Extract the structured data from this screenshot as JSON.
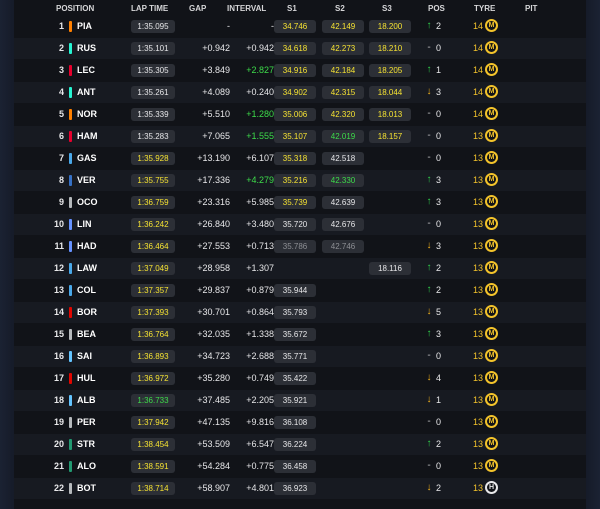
{
  "headers": {
    "position": "POSITION",
    "lap_time": "LAP TIME",
    "gap": "GAP",
    "interval": "INTERVAL",
    "s1": "S1",
    "s2": "S2",
    "s3": "S3",
    "pos": "POS",
    "tyre": "TYRE",
    "pit": "PIT"
  },
  "colors": {
    "yellow_sector": "#f5e232",
    "green_sector": "#3ddc4a",
    "pos_up": "#2fcf4a",
    "pos_down": "#f3b21b",
    "medium_tyre": "#f3c32b"
  },
  "rows": [
    {
      "pos": "1",
      "code": "PIA",
      "team_color": "#ff8000",
      "lap": "1:35.095",
      "lap_c": "white",
      "gap": "-",
      "interval": "-",
      "int_c": "white",
      "s1": "34.746",
      "s1_c": "yellow",
      "s2": "42.149",
      "s2_c": "yellow",
      "s3": "18.200",
      "s3_c": "yellow",
      "arrow": "up",
      "pchange": "2",
      "laps": "14",
      "tyre": "M"
    },
    {
      "pos": "2",
      "code": "RUS",
      "team_color": "#27f4d2",
      "lap": "1:35.101",
      "lap_c": "white",
      "gap": "+0.942",
      "interval": "+0.942",
      "int_c": "white",
      "s1": "34.618",
      "s1_c": "yellow",
      "s2": "42.273",
      "s2_c": "yellow",
      "s3": "18.210",
      "s3_c": "yellow",
      "arrow": "same",
      "pchange": "0",
      "laps": "14",
      "tyre": "M"
    },
    {
      "pos": "3",
      "code": "LEC",
      "team_color": "#e8002d",
      "lap": "1:35.305",
      "lap_c": "white",
      "gap": "+3.849",
      "interval": "+2.827",
      "int_c": "green",
      "s1": "34.916",
      "s1_c": "yellow",
      "s2": "42.184",
      "s2_c": "yellow",
      "s3": "18.205",
      "s3_c": "yellow",
      "arrow": "up",
      "pchange": "1",
      "laps": "14",
      "tyre": "M"
    },
    {
      "pos": "4",
      "code": "ANT",
      "team_color": "#27f4d2",
      "lap": "1:35.261",
      "lap_c": "white",
      "gap": "+4.089",
      "interval": "+0.240",
      "int_c": "white",
      "s1": "34.902",
      "s1_c": "yellow",
      "s2": "42.315",
      "s2_c": "yellow",
      "s3": "18.044",
      "s3_c": "yellow",
      "arrow": "down",
      "pchange": "3",
      "laps": "14",
      "tyre": "M"
    },
    {
      "pos": "5",
      "code": "NOR",
      "team_color": "#ff8000",
      "lap": "1:35.339",
      "lap_c": "white",
      "gap": "+5.510",
      "interval": "+1.280",
      "int_c": "green",
      "s1": "35.006",
      "s1_c": "yellow",
      "s2": "42.320",
      "s2_c": "yellow",
      "s3": "18.013",
      "s3_c": "yellow",
      "arrow": "same",
      "pchange": "0",
      "laps": "14",
      "tyre": "M"
    },
    {
      "pos": "6",
      "code": "HAM",
      "team_color": "#e8002d",
      "lap": "1:35.283",
      "lap_c": "white",
      "gap": "+7.065",
      "interval": "+1.555",
      "int_c": "green",
      "s1": "35.107",
      "s1_c": "yellow",
      "s2": "42.019",
      "s2_c": "green",
      "s3": "18.157",
      "s3_c": "yellow",
      "arrow": "same",
      "pchange": "0",
      "laps": "13",
      "tyre": "M"
    },
    {
      "pos": "7",
      "code": "GAS",
      "team_color": "#4aa8e8",
      "lap": "1:35.928",
      "lap_c": "yellow",
      "gap": "+13.190",
      "interval": "+6.107",
      "int_c": "white",
      "s1": "35.318",
      "s1_c": "yellow",
      "s2": "42.518",
      "s2_c": "white",
      "s3": "",
      "s3_c": "white",
      "arrow": "same",
      "pchange": "0",
      "laps": "13",
      "tyre": "M"
    },
    {
      "pos": "8",
      "code": "VER",
      "team_color": "#3671c6",
      "lap": "1:35.755",
      "lap_c": "yellow",
      "gap": "+17.336",
      "interval": "+4.279",
      "int_c": "green",
      "s1": "35.216",
      "s1_c": "yellow",
      "s2": "42.330",
      "s2_c": "green",
      "s3": "",
      "s3_c": "white",
      "arrow": "up",
      "pchange": "3",
      "laps": "13",
      "tyre": "M"
    },
    {
      "pos": "9",
      "code": "OCO",
      "team_color": "#b6babd",
      "lap": "1:36.759",
      "lap_c": "yellow",
      "gap": "+23.316",
      "interval": "+5.985",
      "int_c": "white",
      "s1": "35.739",
      "s1_c": "yellow",
      "s2": "42.639",
      "s2_c": "white",
      "s3": "",
      "s3_c": "white",
      "arrow": "up",
      "pchange": "3",
      "laps": "13",
      "tyre": "M"
    },
    {
      "pos": "10",
      "code": "LIN",
      "team_color": "#6692ff",
      "lap": "1:36.242",
      "lap_c": "yellow",
      "gap": "+26.840",
      "interval": "+3.480",
      "int_c": "white",
      "s1": "35.720",
      "s1_c": "white",
      "s2": "42.676",
      "s2_c": "white",
      "s3": "",
      "s3_c": "white",
      "arrow": "same",
      "pchange": "0",
      "laps": "13",
      "tyre": "M"
    },
    {
      "pos": "11",
      "code": "HAD",
      "team_color": "#6692ff",
      "lap": "1:36.464",
      "lap_c": "yellow",
      "gap": "+27.553",
      "interval": "+0.713",
      "int_c": "white",
      "s1": "35.786",
      "s1_c": "grey",
      "s2": "42.746",
      "s2_c": "grey",
      "s3": "",
      "s3_c": "white",
      "arrow": "down",
      "pchange": "3",
      "laps": "13",
      "tyre": "M"
    },
    {
      "pos": "12",
      "code": "LAW",
      "team_color": "#4aa8e8",
      "lap": "1:37.049",
      "lap_c": "yellow",
      "gap": "+28.958",
      "interval": "+1.307",
      "int_c": "white",
      "s1": "",
      "s1_c": "white",
      "s2": "",
      "s2_c": "white",
      "s3": "18.116",
      "s3_c": "white",
      "arrow": "up",
      "pchange": "2",
      "laps": "13",
      "tyre": "M"
    },
    {
      "pos": "13",
      "code": "COL",
      "team_color": "#4aa8e8",
      "lap": "1:37.357",
      "lap_c": "yellow",
      "gap": "+29.837",
      "interval": "+0.879",
      "int_c": "white",
      "s1": "35.944",
      "s1_c": "white",
      "s2": "",
      "s2_c": "white",
      "s3": "",
      "s3_c": "white",
      "arrow": "up",
      "pchange": "2",
      "laps": "13",
      "tyre": "M"
    },
    {
      "pos": "14",
      "code": "BOR",
      "team_color": "#e10600",
      "lap": "1:37.393",
      "lap_c": "yellow",
      "gap": "+30.701",
      "interval": "+0.864",
      "int_c": "white",
      "s1": "35.793",
      "s1_c": "white",
      "s2": "",
      "s2_c": "white",
      "s3": "",
      "s3_c": "white",
      "arrow": "down",
      "pchange": "5",
      "laps": "13",
      "tyre": "M"
    },
    {
      "pos": "15",
      "code": "BEA",
      "team_color": "#b6babd",
      "lap": "1:36.764",
      "lap_c": "yellow",
      "gap": "+32.035",
      "interval": "+1.338",
      "int_c": "white",
      "s1": "35.672",
      "s1_c": "white",
      "s2": "",
      "s2_c": "white",
      "s3": "",
      "s3_c": "white",
      "arrow": "up",
      "pchange": "3",
      "laps": "13",
      "tyre": "M"
    },
    {
      "pos": "16",
      "code": "SAI",
      "team_color": "#64c4ff",
      "lap": "1:36.893",
      "lap_c": "yellow",
      "gap": "+34.723",
      "interval": "+2.688",
      "int_c": "white",
      "s1": "35.771",
      "s1_c": "white",
      "s2": "",
      "s2_c": "white",
      "s3": "",
      "s3_c": "white",
      "arrow": "same",
      "pchange": "0",
      "laps": "13",
      "tyre": "M"
    },
    {
      "pos": "17",
      "code": "HUL",
      "team_color": "#e10600",
      "lap": "1:36.972",
      "lap_c": "yellow",
      "gap": "+35.280",
      "interval": "+0.749",
      "int_c": "white",
      "s1": "35.422",
      "s1_c": "white",
      "s2": "",
      "s2_c": "white",
      "s3": "",
      "s3_c": "white",
      "arrow": "down",
      "pchange": "4",
      "laps": "13",
      "tyre": "M"
    },
    {
      "pos": "18",
      "code": "ALB",
      "team_color": "#64c4ff",
      "lap": "1:36.733",
      "lap_c": "green",
      "gap": "+37.485",
      "interval": "+2.205",
      "int_c": "white",
      "s1": "35.921",
      "s1_c": "white",
      "s2": "",
      "s2_c": "white",
      "s3": "",
      "s3_c": "white",
      "arrow": "down",
      "pchange": "1",
      "laps": "13",
      "tyre": "M"
    },
    {
      "pos": "19",
      "code": "PER",
      "team_color": "#b6babd",
      "lap": "1:37.942",
      "lap_c": "yellow",
      "gap": "+47.135",
      "interval": "+9.816",
      "int_c": "white",
      "s1": "36.108",
      "s1_c": "white",
      "s2": "",
      "s2_c": "white",
      "s3": "",
      "s3_c": "white",
      "arrow": "same",
      "pchange": "0",
      "laps": "13",
      "tyre": "M"
    },
    {
      "pos": "20",
      "code": "STR",
      "team_color": "#229971",
      "lap": "1:38.454",
      "lap_c": "yellow",
      "gap": "+53.509",
      "interval": "+6.547",
      "int_c": "white",
      "s1": "36.224",
      "s1_c": "white",
      "s2": "",
      "s2_c": "white",
      "s3": "",
      "s3_c": "white",
      "arrow": "up",
      "pchange": "2",
      "laps": "13",
      "tyre": "M"
    },
    {
      "pos": "21",
      "code": "ALO",
      "team_color": "#229971",
      "lap": "1:38.591",
      "lap_c": "yellow",
      "gap": "+54.284",
      "interval": "+0.775",
      "int_c": "white",
      "s1": "36.458",
      "s1_c": "white",
      "s2": "",
      "s2_c": "white",
      "s3": "",
      "s3_c": "white",
      "arrow": "same",
      "pchange": "0",
      "laps": "13",
      "tyre": "M"
    },
    {
      "pos": "22",
      "code": "BOT",
      "team_color": "#b6babd",
      "lap": "1:38.714",
      "lap_c": "yellow",
      "gap": "+58.907",
      "interval": "+4.801",
      "int_c": "white",
      "s1": "36.923",
      "s1_c": "white",
      "s2": "",
      "s2_c": "white",
      "s3": "",
      "s3_c": "white",
      "arrow": "down",
      "pchange": "2",
      "laps": "13",
      "tyre": "H"
    }
  ]
}
